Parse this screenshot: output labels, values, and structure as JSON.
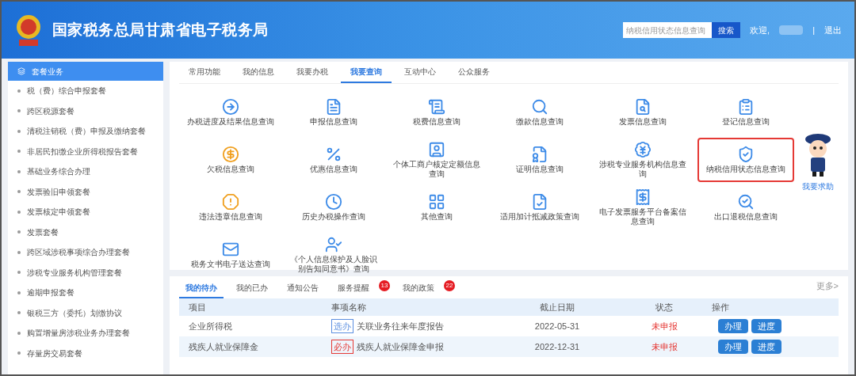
{
  "header": {
    "title": "国家税务总局甘肃省电子税务局",
    "search": {
      "placeholder": "纳税信用状态信息查询",
      "button": "搜索"
    },
    "welcome": "欢迎,",
    "separator": "|",
    "logout": "退出"
  },
  "sidebar": {
    "title": "套餐业务",
    "items": [
      {
        "label": "税（费）综合申报套餐"
      },
      {
        "label": "跨区税源套餐"
      },
      {
        "label": "清税注销税（费）申报及缴纳套餐"
      },
      {
        "label": "非居民扣缴企业所得税报告套餐"
      },
      {
        "label": "基础业务综合办理"
      },
      {
        "label": "发票验旧申领套餐"
      },
      {
        "label": "发票核定申领套餐"
      },
      {
        "label": "发票套餐"
      },
      {
        "label": "跨区域涉税事项综合办理套餐"
      },
      {
        "label": "涉税专业服务机构管理套餐"
      },
      {
        "label": "逾期申报套餐"
      },
      {
        "label": "银税三方（委托）划缴协议"
      },
      {
        "label": "购置增量房涉税业务办理套餐"
      },
      {
        "label": "存量房交易套餐"
      }
    ]
  },
  "main_tabs": [
    {
      "label": "常用功能",
      "selected": false
    },
    {
      "label": "我的信息",
      "selected": false
    },
    {
      "label": "我要办税",
      "selected": false
    },
    {
      "label": "我要查询",
      "selected": true
    },
    {
      "label": "互动中心",
      "selected": false
    },
    {
      "label": "公众服务",
      "selected": false
    }
  ],
  "queries": [
    {
      "label": "办税进度及结果信息查询",
      "highlighted": false
    },
    {
      "label": "申报信息查询",
      "highlighted": false
    },
    {
      "label": "税费信息查询",
      "highlighted": false
    },
    {
      "label": "缴款信息查询",
      "highlighted": false
    },
    {
      "label": "发票信息查询",
      "highlighted": false
    },
    {
      "label": "登记信息查询",
      "highlighted": false
    },
    {
      "label": "欠税信息查询",
      "highlighted": false
    },
    {
      "label": "优惠信息查询",
      "highlighted": false
    },
    {
      "label": "个体工商户核定定额信息查询",
      "highlighted": false
    },
    {
      "label": "证明信息查询",
      "highlighted": false
    },
    {
      "label": "涉税专业服务机构信息查询",
      "highlighted": false
    },
    {
      "label": "纳税信用状态信息查询",
      "highlighted": true
    },
    {
      "label": "违法违章信息查询",
      "highlighted": false
    },
    {
      "label": "历史办税操作查询",
      "highlighted": false
    },
    {
      "label": "其他查询",
      "highlighted": false
    },
    {
      "label": "适用加计抵减政策查询",
      "highlighted": false
    },
    {
      "label": "电子发票服务平台备案信息查询",
      "highlighted": false
    },
    {
      "label": "出口退税信息查询",
      "highlighted": false
    },
    {
      "label": "税务文书电子送达查询",
      "highlighted": false
    },
    {
      "label": "《个人信息保护及人脸识别告知同意书》查询",
      "highlighted": false
    }
  ],
  "help": {
    "label": "我要求助"
  },
  "todo_tabs": [
    {
      "label": "我的待办",
      "selected": true
    },
    {
      "label": "我的已办",
      "selected": false
    },
    {
      "label": "通知公告",
      "selected": false
    },
    {
      "label": "服务提醒",
      "selected": false,
      "badge": "13"
    },
    {
      "label": "我的政策",
      "selected": false,
      "badge": "22"
    }
  ],
  "more": "更多>",
  "table": {
    "columns": [
      "项目",
      "事项名称",
      "截止日期",
      "状态",
      "操作"
    ],
    "rows": [
      {
        "project": "企业所得税",
        "tag": {
          "text": "选办",
          "color": "#5b8fe0"
        },
        "name": "关联业务往来年度报告",
        "deadline": "2022-05-31",
        "status": "未申报",
        "actions": [
          "办理",
          "进度"
        ]
      },
      {
        "project": "残疾人就业保障金",
        "tag": {
          "text": "必办",
          "color": "#e53935"
        },
        "name": "残疾人就业保障金申报",
        "deadline": "2022-12-31",
        "status": "未申报",
        "actions": [
          "办理",
          "进度"
        ]
      }
    ]
  }
}
